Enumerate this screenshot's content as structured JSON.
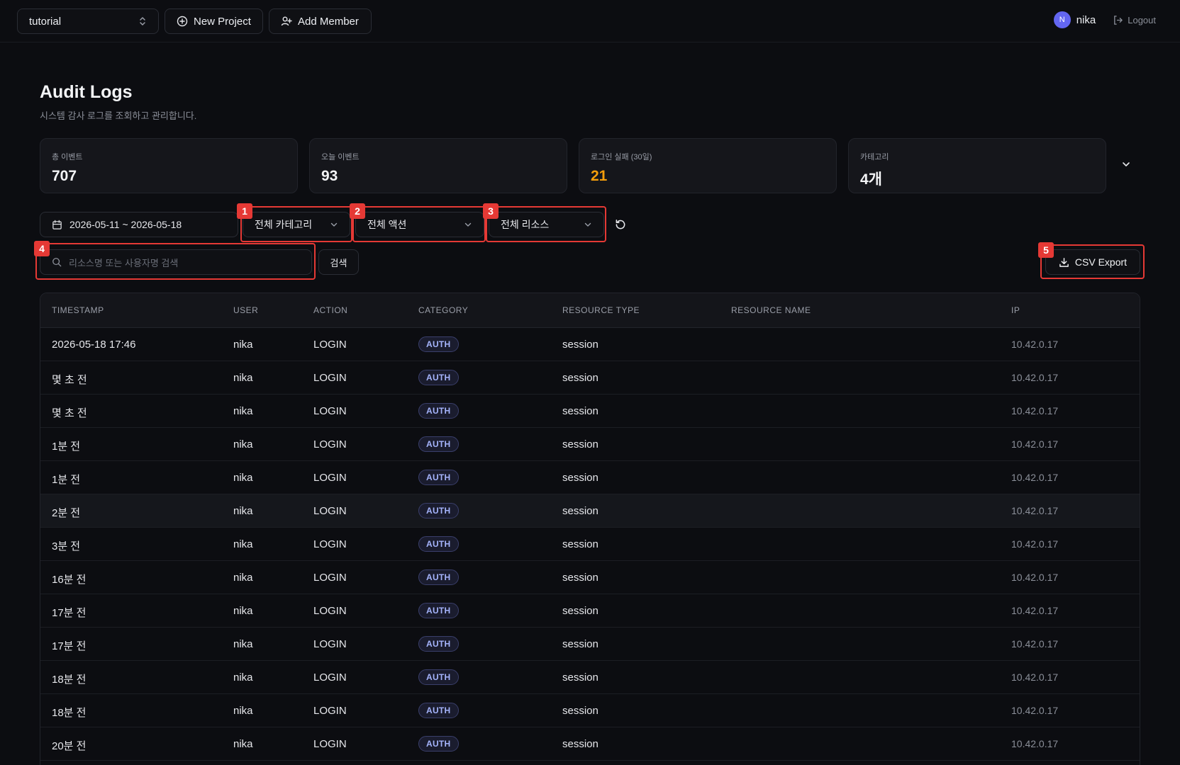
{
  "header": {
    "project": "tutorial",
    "new_project": "New Project",
    "add_member": "Add Member",
    "avatar_initial": "N",
    "username": "nika",
    "logout": "Logout"
  },
  "page": {
    "title": "Audit Logs",
    "subtitle": "시스템 감사 로그를 조회하고 관리합니다."
  },
  "stats": [
    {
      "label": "총 이벤트",
      "value": "707"
    },
    {
      "label": "오늘 이벤트",
      "value": "93"
    },
    {
      "label": "로그인 실패 (30일)",
      "value": "21"
    },
    {
      "label": "카테고리",
      "value": "4개"
    }
  ],
  "filters": {
    "date_range": "2026-05-11 ~ 2026-05-18",
    "category": "전체 카테고리",
    "action": "전체 액션",
    "resource": "전체 리소스",
    "search_placeholder": "리소스명 또는 사용자명 검색",
    "search_button": "검색",
    "export_button": "CSV Export"
  },
  "annotations": [
    "1",
    "2",
    "3",
    "4",
    "5"
  ],
  "table": {
    "columns": [
      "TIMESTAMP",
      "USER",
      "ACTION",
      "CATEGORY",
      "RESOURCE TYPE",
      "RESOURCE NAME",
      "IP"
    ],
    "rows": [
      {
        "ts": "2026-05-18 17:46",
        "user": "nika",
        "action": "LOGIN",
        "category": "AUTH",
        "rtype": "session",
        "rname": "",
        "ip": "10.42.0.17"
      },
      {
        "ts": "몇 초 전",
        "user": "nika",
        "action": "LOGIN",
        "category": "AUTH",
        "rtype": "session",
        "rname": "",
        "ip": "10.42.0.17"
      },
      {
        "ts": "몇 초 전",
        "user": "nika",
        "action": "LOGIN",
        "category": "AUTH",
        "rtype": "session",
        "rname": "",
        "ip": "10.42.0.17"
      },
      {
        "ts": "1분 전",
        "user": "nika",
        "action": "LOGIN",
        "category": "AUTH",
        "rtype": "session",
        "rname": "",
        "ip": "10.42.0.17"
      },
      {
        "ts": "1분 전",
        "user": "nika",
        "action": "LOGIN",
        "category": "AUTH",
        "rtype": "session",
        "rname": "",
        "ip": "10.42.0.17"
      },
      {
        "ts": "2분 전",
        "user": "nika",
        "action": "LOGIN",
        "category": "AUTH",
        "rtype": "session",
        "rname": "",
        "ip": "10.42.0.17"
      },
      {
        "ts": "3분 전",
        "user": "nika",
        "action": "LOGIN",
        "category": "AUTH",
        "rtype": "session",
        "rname": "",
        "ip": "10.42.0.17"
      },
      {
        "ts": "16분 전",
        "user": "nika",
        "action": "LOGIN",
        "category": "AUTH",
        "rtype": "session",
        "rname": "",
        "ip": "10.42.0.17"
      },
      {
        "ts": "17분 전",
        "user": "nika",
        "action": "LOGIN",
        "category": "AUTH",
        "rtype": "session",
        "rname": "",
        "ip": "10.42.0.17"
      },
      {
        "ts": "17분 전",
        "user": "nika",
        "action": "LOGIN",
        "category": "AUTH",
        "rtype": "session",
        "rname": "",
        "ip": "10.42.0.17"
      },
      {
        "ts": "18분 전",
        "user": "nika",
        "action": "LOGIN",
        "category": "AUTH",
        "rtype": "session",
        "rname": "",
        "ip": "10.42.0.17"
      },
      {
        "ts": "18분 전",
        "user": "nika",
        "action": "LOGIN",
        "category": "AUTH",
        "rtype": "session",
        "rname": "",
        "ip": "10.42.0.17"
      },
      {
        "ts": "20분 전",
        "user": "nika",
        "action": "LOGIN",
        "category": "AUTH",
        "rtype": "session",
        "rname": "",
        "ip": "10.42.0.17"
      }
    ]
  },
  "colors": {
    "background": "#0c0d11",
    "accent": "#6366f1",
    "warning": "#f59e0b",
    "annotation": "#e53935",
    "badge_text": "#a5b4fc"
  }
}
